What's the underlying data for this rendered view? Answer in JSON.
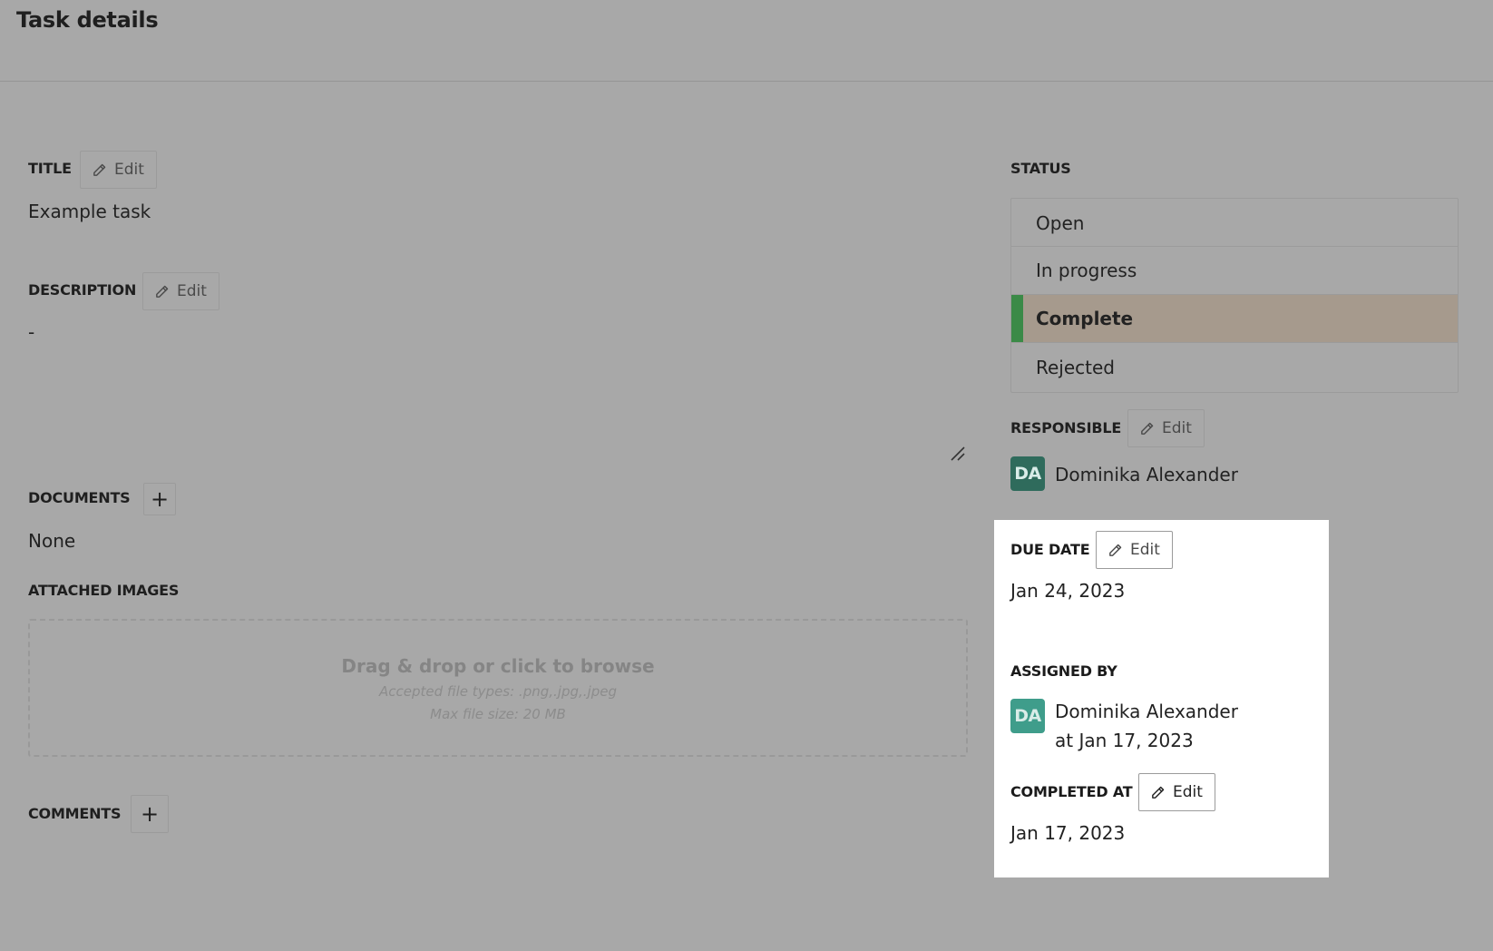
{
  "page": {
    "title": "Task details"
  },
  "title_section": {
    "label": "TITLE",
    "edit_label": "Edit",
    "value": "Example task"
  },
  "description_section": {
    "label": "DESCRIPTION",
    "edit_label": "Edit",
    "value": "-"
  },
  "documents_section": {
    "label": "DOCUMENTS",
    "add_label": "+",
    "value": "None"
  },
  "attached_images": {
    "label": "ATTACHED IMAGES",
    "dropzone_title": "Drag & drop or click to browse",
    "accepted_types": "Accepted file types: .png,.jpg,.jpeg",
    "max_size": "Max file size: 20 MB"
  },
  "comments_section": {
    "label": "COMMENTS",
    "add_label": "+"
  },
  "status": {
    "label": "STATUS",
    "options": [
      {
        "label": "Open"
      },
      {
        "label": "In progress"
      },
      {
        "label": "Complete"
      },
      {
        "label": "Rejected"
      }
    ],
    "selected": "Complete",
    "selected_color": "#3b8a47"
  },
  "responsible": {
    "label": "RESPONSIBLE",
    "edit_label": "Edit",
    "avatar_initials": "DA",
    "avatar_color": "#2f6b5c",
    "name": "Dominika Alexander"
  },
  "due_date": {
    "label": "DUE DATE",
    "edit_label": "Edit",
    "value": "Jan 24, 2023"
  },
  "assigned_by": {
    "label": "ASSIGNED BY",
    "avatar_initials": "DA",
    "avatar_color": "#3f9d8b",
    "name": "Dominika Alexander",
    "date": "at Jan 17, 2023"
  },
  "completed_at": {
    "label": "COMPLETED AT",
    "edit_label": "Edit",
    "value": "Jan 17, 2023"
  },
  "icons": {
    "edit": "pencil-icon",
    "add": "plus-icon",
    "resize": "resize-handle-icon"
  },
  "colors": {
    "overlay_background": "#a8a8a8",
    "highlight_background": "#ffffff"
  }
}
